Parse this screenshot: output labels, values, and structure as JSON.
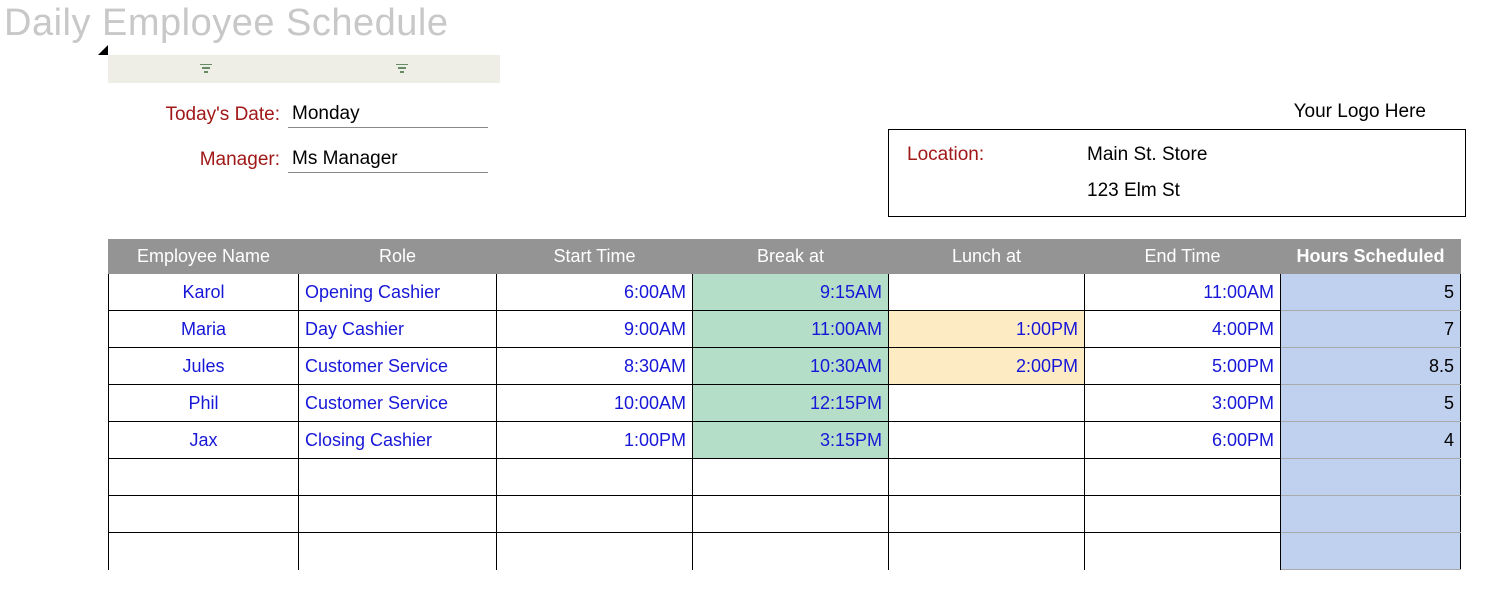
{
  "title": "Daily Employee Schedule",
  "labels": {
    "date": "Today's Date:",
    "manager": "Manager:",
    "location": "Location:",
    "logo": "Your Logo Here"
  },
  "info": {
    "date": "Monday",
    "manager": "Ms Manager",
    "location_name": "Main St. Store",
    "location_addr": "123 Elm St"
  },
  "headers": {
    "name": "Employee Name",
    "role": "Role",
    "start": "Start Time",
    "break": "Break at",
    "lunch": "Lunch at",
    "end": "End Time",
    "hours": "Hours Scheduled"
  },
  "rows": [
    {
      "name": "Karol",
      "role": "Opening Cashier",
      "start": "6:00AM",
      "break": "9:15AM",
      "lunch": "",
      "end": "11:00AM",
      "hours": "5"
    },
    {
      "name": "Maria",
      "role": "Day Cashier",
      "start": "9:00AM",
      "break": "11:00AM",
      "lunch": "1:00PM",
      "end": "4:00PM",
      "hours": "7"
    },
    {
      "name": "Jules",
      "role": "Customer Service",
      "start": "8:30AM",
      "break": "10:30AM",
      "lunch": "2:00PM",
      "end": "5:00PM",
      "hours": "8.5"
    },
    {
      "name": "Phil",
      "role": "Customer Service",
      "start": "10:00AM",
      "break": "12:15PM",
      "lunch": "",
      "end": "3:00PM",
      "hours": "5"
    },
    {
      "name": "Jax",
      "role": "Closing Cashier",
      "start": "1:00PM",
      "break": "3:15PM",
      "lunch": "",
      "end": "6:00PM",
      "hours": "4"
    }
  ],
  "empty_rows": 3
}
